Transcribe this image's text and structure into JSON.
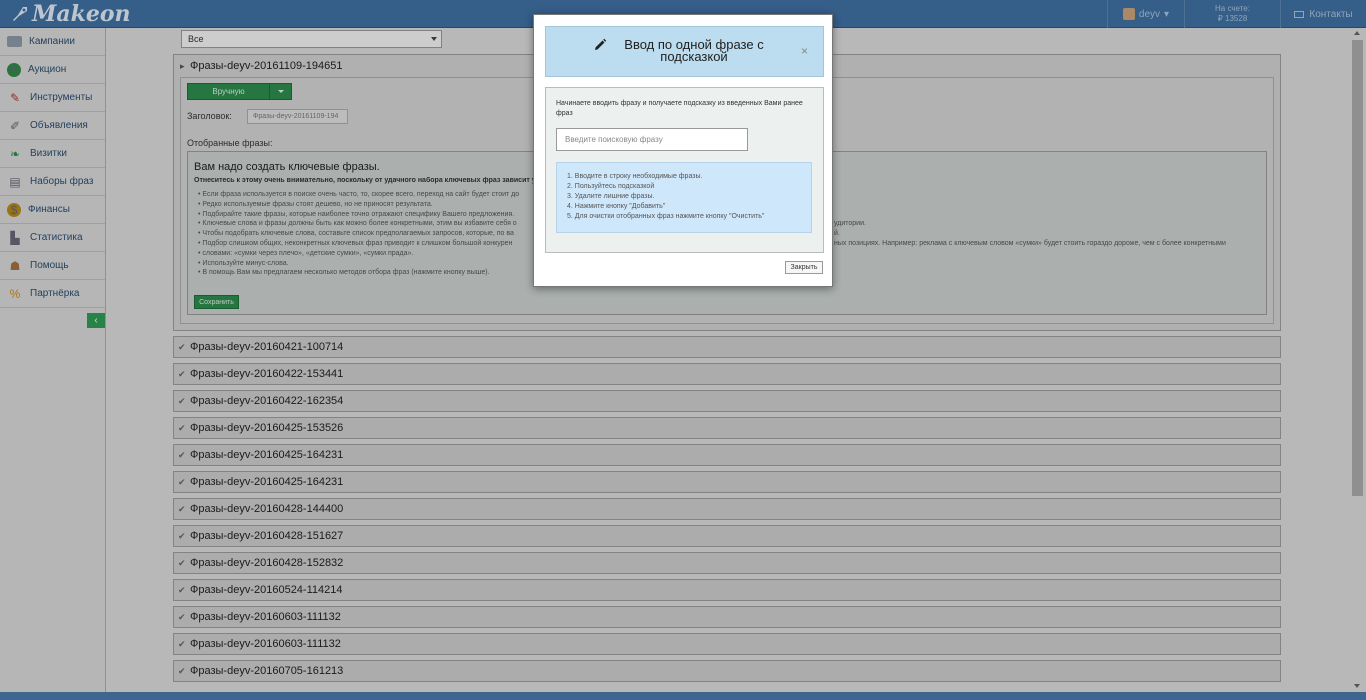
{
  "app": {
    "logo_text": "Makeon"
  },
  "topbar": {
    "user_name": "deyv",
    "balance_label": "На счете:",
    "balance_value": "₽ 13528",
    "contacts_label": "Контакты"
  },
  "sidebar": {
    "items": [
      {
        "label": "Кампании",
        "icon": "campaign-icon"
      },
      {
        "label": "Аукцион",
        "icon": "auction-icon"
      },
      {
        "label": "Инструменты",
        "icon": "tools-icon"
      },
      {
        "label": "Объявления",
        "icon": "ads-icon"
      },
      {
        "label": "Визитки",
        "icon": "cards-icon"
      },
      {
        "label": "Наборы фраз",
        "icon": "phrases-icon"
      },
      {
        "label": "Финансы",
        "icon": "finance-icon"
      },
      {
        "label": "Статистика",
        "icon": "stats-icon"
      },
      {
        "label": "Помощь",
        "icon": "help-icon"
      },
      {
        "label": "Партнёрка",
        "icon": "partner-icon"
      }
    ]
  },
  "filter": {
    "selected": "Все"
  },
  "open_set": {
    "title": "Фразы-deyv-20161109-194651",
    "manual_button": "Вручную",
    "header_label": "Заголовок:",
    "header_value": "Фразы-deyv-20161109-194",
    "selected_label": "Отобранные фразы:",
    "info_title": "Вам надо создать ключевые фразы.",
    "info_subtitle": "Отнеситесь к этому очень внимательно, поскольку от удачного набора ключевых фраз зависит успех",
    "info_items": [
      "Если фраза используется в поиске очень часто, то, скорее всего, переход на сайт будет стоит до",
      "Редко используемые фразы стоят дешево, но не приносят результата.",
      "Подбирайте такие фразы, которые наиболее точно отражают специфику Вашего предложения.",
      "Ключевые слова и фразы должны быть как можно более конкретными, этим вы избавите себя о",
      "Чтобы подобрать ключевые слова, составьте список предполагаемых запросов, которые, по ва",
      "Подбор слишком общих, неконкретных ключевых фраз приводит к слишком большой конкурен",
      "словами: «сумки через плечо», «детские сумки», «сумки прада».",
      "Используйте минус-слова.",
      "В помощь Вам мы предлагаем несколько методов отбора фраз (нажмите кнопку выше)."
    ],
    "info_right_1": "удитории.",
    "info_right_2": "й.",
    "info_right_3": "ных позициях. Например: реклама с ключевым словом «сумки» будет стоить гораздо дороже, чем с более конкретными",
    "save_button": "Сохранить"
  },
  "sets": [
    "Фразы-deyv-20160421-100714",
    "Фразы-deyv-20160422-153441",
    "Фразы-deyv-20160422-162354",
    "Фразы-deyv-20160425-153526",
    "Фразы-deyv-20160425-164231",
    "Фразы-deyv-20160425-164231",
    "Фразы-deyv-20160428-144400",
    "Фразы-deyv-20160428-151627",
    "Фразы-deyv-20160428-152832",
    "Фразы-deyv-20160524-114214",
    "Фразы-deyv-20160603-111132",
    "Фразы-deyv-20160603-111132",
    "Фразы-deyv-20160705-161213"
  ],
  "modal": {
    "title": "Ввод по одной фразе с подсказкой",
    "close_x": "×",
    "hint": "Начинаете вводить фразу и получаете подсказку из введенных Вами ранее фраз",
    "search_placeholder": "Введите поисковую фразу",
    "steps": [
      "1. Вводите в строку необходимые фразы.",
      "2. Пользуйтесь подсказкой",
      "3. Удалите лишние фразы.",
      "4. Нажмите кнопку \"Добавить\"",
      "5. Для очистки отобранных фраз нажмите кнопку \"Очистить\""
    ],
    "close_button": "Закрыть"
  }
}
